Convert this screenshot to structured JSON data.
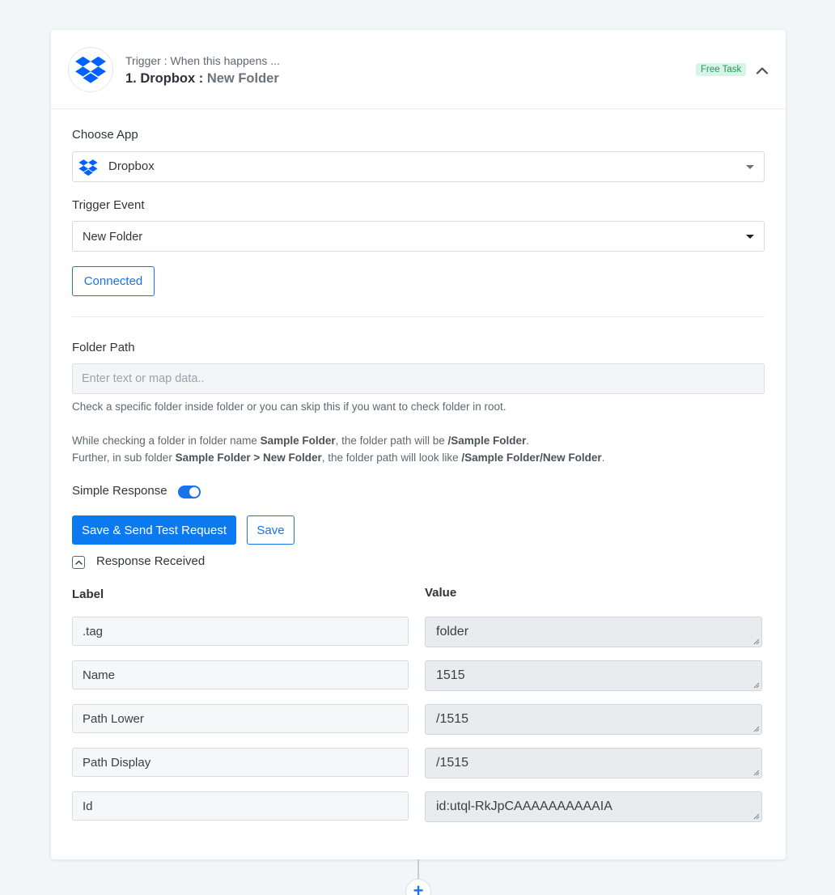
{
  "colors": {
    "accent": "#1a73e8",
    "primary_button": "#0b79f0",
    "dropbox_blue": "#0061fe",
    "badge_bg": "#d7f5e6",
    "badge_text": "#1d9a5c"
  },
  "header": {
    "icon": "dropbox-icon",
    "trigger_label": "Trigger : When this happens ...",
    "step_title": "1. Dropbox : ",
    "step_event": "New Folder",
    "badge": "Free Task",
    "collapse_icon": "chevron-up-icon"
  },
  "choose_app": {
    "label": "Choose App",
    "selected_icon": "dropbox-icon",
    "selected": "Dropbox"
  },
  "trigger_event": {
    "label": "Trigger Event",
    "selected": "New Folder"
  },
  "connection": {
    "button_label": "Connected"
  },
  "folder_path": {
    "label": "Folder Path",
    "placeholder": "Enter text or map data..",
    "value": "",
    "help_line1": "Check a specific folder inside folder or you can skip this if you want to check folder in root.",
    "help_line2": {
      "t1": "While checking a folder in folder name ",
      "b1": "Sample Folder",
      "t2": ", the folder path will be ",
      "b2": "/Sample Folder",
      "t3": "."
    },
    "help_line3": {
      "t1": "Further, in sub folder ",
      "b1": "Sample Folder > New Folder",
      "t2": ", the folder path will look like ",
      "b2": "/Sample Folder/New Folder",
      "t3": "."
    }
  },
  "simple_response": {
    "label": "Simple Response",
    "enabled": true
  },
  "actions": {
    "save_and_send": "Save & Send Test Request",
    "save": "Save"
  },
  "response": {
    "toggle_icon": "chevron-up-icon",
    "title": "Response Received",
    "label_header": "Label",
    "value_header": "Value",
    "rows": [
      {
        "label": ".tag",
        "value": "folder"
      },
      {
        "label": "Name",
        "value": "1515"
      },
      {
        "label": "Path Lower",
        "value": "/1515"
      },
      {
        "label": "Path Display",
        "value": "/1515"
      },
      {
        "label": "Id",
        "value": "id:utql-RkJpCAAAAAAAAAAIA"
      }
    ]
  },
  "add_step": {
    "icon": "plus-icon",
    "label": "+"
  }
}
